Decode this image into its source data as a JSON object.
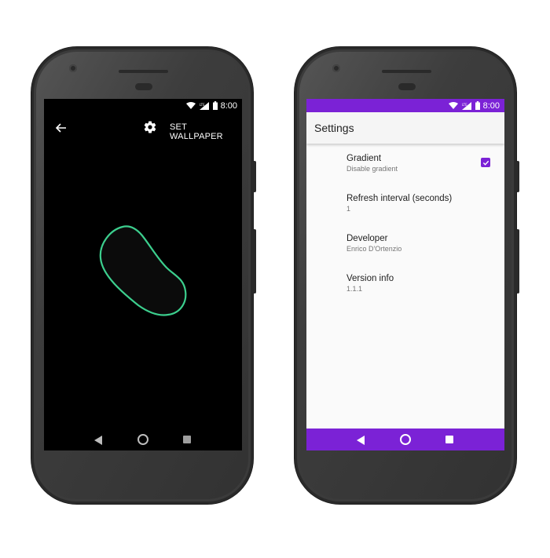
{
  "colors": {
    "phone_body": "#3b3b3b",
    "accent_purple": "#7b22d6",
    "blob_stroke": "#3ccf8e",
    "left_bg": "#000000",
    "right_bg": "#fafafa"
  },
  "left_phone": {
    "status_time": "8:00",
    "status_icons": [
      "wifi-icon",
      "signal-lte-icon",
      "battery-icon"
    ],
    "toolbar": {
      "back_icon": "arrow-left-icon",
      "settings_icon": "gear-icon",
      "set_wallpaper_label": "SET WALLPAPER"
    },
    "nav": [
      "back-triangle-icon",
      "home-circle-icon",
      "recents-square-icon"
    ]
  },
  "right_phone": {
    "status_time": "8:00",
    "status_icons": [
      "wifi-icon",
      "signal-lte-icon",
      "battery-icon"
    ],
    "appbar_title": "Settings",
    "preferences": [
      {
        "title": "Gradient",
        "summary": "Disable gradient",
        "checked": true
      },
      {
        "title": "Refresh interval (seconds)",
        "summary": "1"
      },
      {
        "title": "Developer",
        "summary": "Enrico D'Ortenzio"
      },
      {
        "title": "Version info",
        "summary": "1.1.1"
      }
    ],
    "nav": [
      "back-triangle-icon",
      "home-circle-icon",
      "recents-square-icon"
    ]
  }
}
